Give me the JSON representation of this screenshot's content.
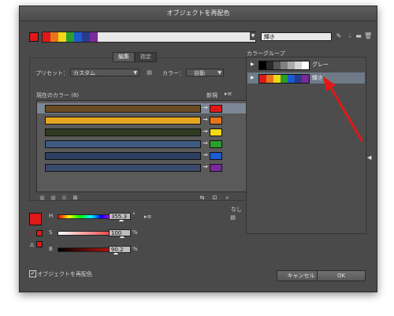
{
  "window": {
    "title": "オブジェクトを再配色"
  },
  "top_bar": {
    "strip_colors": [
      "#e01818",
      "#e8751a",
      "#f2d818",
      "#2aa02a",
      "#1d5bd0",
      "#283c8c",
      "#7a2a9a"
    ],
    "group_name_value": "輝き"
  },
  "tabs": {
    "edit": "編集",
    "assign": "指定"
  },
  "preset": {
    "label": "プリセット：",
    "value": "カスタム"
  },
  "colors_control": {
    "label": "カラー：",
    "value": "自動"
  },
  "list": {
    "current_header": "現在のカラー (6)",
    "new_header": "新規",
    "rows": [
      {
        "current": "#6b4a23",
        "new": "#e01818"
      },
      {
        "current": "#e6a51f",
        "new": "#e8751a"
      },
      {
        "current": "#2f3a21",
        "new": "#f2d818"
      },
      {
        "current": "#3f5a80",
        "new": "#2aa02a"
      },
      {
        "current": "#2c3f62",
        "new": "#1d5bd0"
      },
      {
        "current": "#3a4a6b",
        "new": "#7a2a9a"
      }
    ]
  },
  "hsb": {
    "swatch": "#e01818",
    "h": {
      "label": "H",
      "value": "355.3",
      "unit": "°",
      "level": 0.987
    },
    "s": {
      "label": "S",
      "value": "100",
      "unit": "%",
      "level": 1.0
    },
    "b": {
      "label": "B",
      "value": "90.2",
      "unit": "%",
      "level": 0.902
    }
  },
  "none_label": "なし",
  "color_groups": {
    "header": "カラーグループ",
    "groups": [
      {
        "name": "グレー",
        "colors": [
          "#000000",
          "#2a2a2a",
          "#555555",
          "#808080",
          "#aaaaaa",
          "#d4d4d4",
          "#ffffff"
        ]
      },
      {
        "name": "輝き",
        "colors": [
          "#e01818",
          "#e8751a",
          "#f2d818",
          "#2aa02a",
          "#1d5bd0",
          "#283c8c",
          "#7a2a9a"
        ]
      }
    ]
  },
  "footer": {
    "recolor_checkbox_label": "オブジェクトを再配色",
    "recolor_checked": true,
    "cancel": "キャンセル",
    "ok": "OK"
  },
  "annotation": {
    "arrow_color": "#e01818"
  }
}
